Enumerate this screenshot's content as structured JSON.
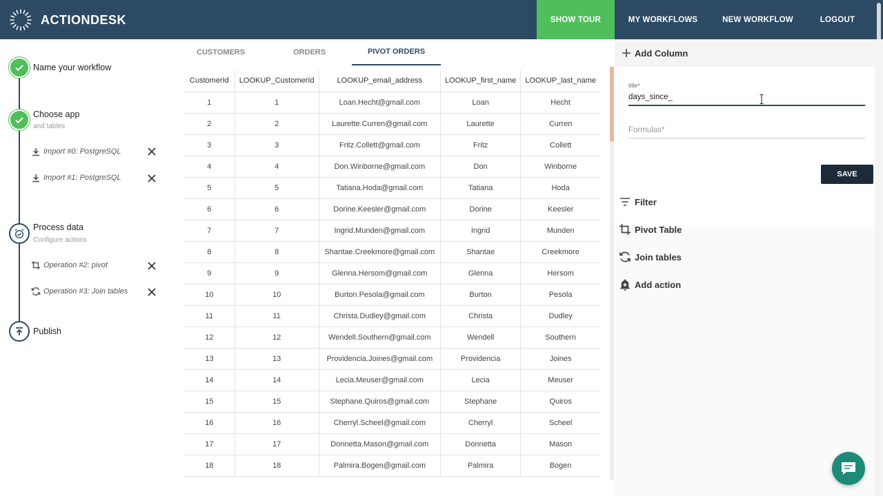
{
  "app": {
    "name": "ACTIONDESK"
  },
  "nav": {
    "show_tour": "SHOW TOUR",
    "my_workflows": "MY WORKFLOWS",
    "new_workflow": "NEW WORKFLOW",
    "logout": "LOGOUT",
    "accent_color": "#4fbf5b",
    "bar_color": "#2c4a63"
  },
  "stepper": {
    "steps": [
      {
        "title": "Name your workflow",
        "subtitle": "",
        "status": "done"
      },
      {
        "title": "Choose app",
        "subtitle": "and tables",
        "status": "done"
      },
      {
        "title": "Process data",
        "subtitle": "Configure actions",
        "status": "current"
      },
      {
        "title": "Publish",
        "subtitle": "",
        "status": "pending"
      }
    ],
    "imports": [
      {
        "label": "Import #0: PostgreSQL",
        "icon": "download-icon"
      },
      {
        "label": "Import #1: PostgreSQL",
        "icon": "download-icon"
      }
    ],
    "operations": [
      {
        "label": "Operation #2: pivot",
        "icon": "crop-icon"
      },
      {
        "label": "Operation #3: Join tables",
        "icon": "join-icon"
      }
    ]
  },
  "tabs": [
    {
      "label": "CUSTOMERS",
      "active": false
    },
    {
      "label": "ORDERS",
      "active": false
    },
    {
      "label": "PIVOT ORDERS",
      "active": true
    }
  ],
  "table": {
    "columns": [
      "CustomerId",
      "LOOKUP_CustomerId",
      "LOOKUP_email_address",
      "LOOKUP_first_name",
      "LOOKUP_last_name"
    ],
    "rows": [
      [
        "1",
        "1",
        "Loan.Hecht@gmail.com",
        "Loan",
        "Hecht"
      ],
      [
        "2",
        "2",
        "Laurette.Curren@gmail.com",
        "Laurette",
        "Curren"
      ],
      [
        "3",
        "3",
        "Fritz.Collett@gmail.com",
        "Fritz",
        "Collett"
      ],
      [
        "4",
        "4",
        "Don.Winborne@gmail.com",
        "Don",
        "Winborne"
      ],
      [
        "5",
        "5",
        "Tatiana.Hoda@gmail.com",
        "Tatiana",
        "Hoda"
      ],
      [
        "6",
        "6",
        "Dorine.Keesler@gmail.com",
        "Dorine",
        "Keesler"
      ],
      [
        "7",
        "7",
        "Ingrid.Munden@gmail.com",
        "Ingrid",
        "Munden"
      ],
      [
        "8",
        "8",
        "Shantae.Creekmore@gmail.com",
        "Shantae",
        "Creekmore"
      ],
      [
        "9",
        "9",
        "Glenna.Hersom@gmail.com",
        "Glenna",
        "Hersom"
      ],
      [
        "10",
        "10",
        "Burton.Pesola@gmail.com",
        "Burton",
        "Pesola"
      ],
      [
        "11",
        "11",
        "Christa.Dudley@gmail.com",
        "Christa",
        "Dudley"
      ],
      [
        "12",
        "12",
        "Wendell.Southern@gmail.com",
        "Wendell",
        "Southern"
      ],
      [
        "13",
        "13",
        "Providencia.Joines@gmail.com",
        "Providencia",
        "Joines"
      ],
      [
        "14",
        "14",
        "Lecia.Meuser@gmail.com",
        "Lecia",
        "Meuser"
      ],
      [
        "15",
        "15",
        "Stephane.Quiros@gmail.com",
        "Stephane",
        "Quiros"
      ],
      [
        "16",
        "16",
        "Cherryl.Scheel@gmail.com",
        "Cherryl",
        "Scheel"
      ],
      [
        "17",
        "17",
        "Donnetta.Mason@gmail.com",
        "Donnetta",
        "Mason"
      ],
      [
        "18",
        "18",
        "Palmira.Bogen@gmail.com",
        "Palmira",
        "Bogen"
      ]
    ]
  },
  "panel": {
    "add_column": {
      "title": "Add Column",
      "icon": "plus-icon"
    },
    "title_field": {
      "label": "title*",
      "value": "days_since_"
    },
    "formulas_field": {
      "placeholder": "Formulas*"
    },
    "save": "SAVE",
    "actions": [
      {
        "label": "Filter",
        "icon": "filter-icon"
      },
      {
        "label": "Pivot Table",
        "icon": "crop-icon"
      },
      {
        "label": "Join tables",
        "icon": "join-icon"
      },
      {
        "label": "Add action",
        "icon": "add-alert-icon"
      }
    ]
  }
}
